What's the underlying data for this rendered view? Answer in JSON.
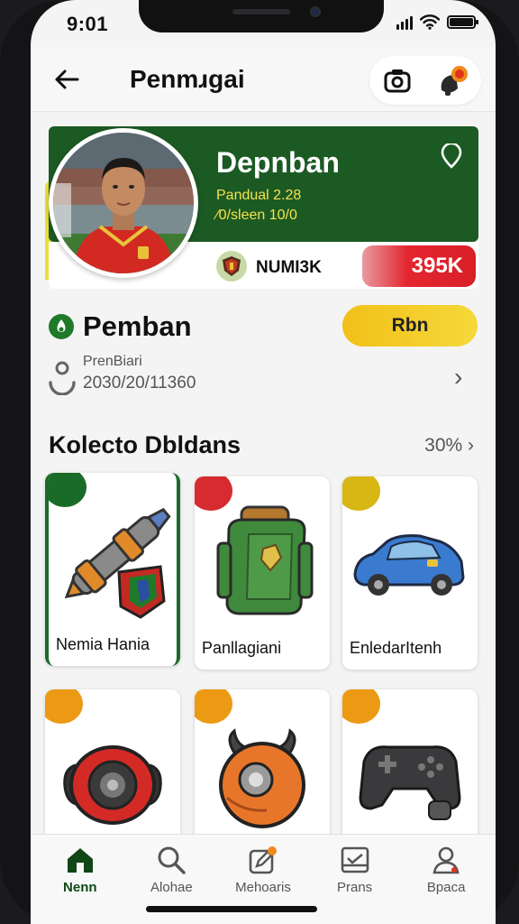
{
  "status_bar": {
    "time": "9:01"
  },
  "header": {
    "title": "Penmɹgai",
    "back_icon": "arrow-left-icon",
    "camera_icon": "camera-icon",
    "profile_icon": "profile-badge-icon"
  },
  "profile_card": {
    "name": "Depnban",
    "line1": "Pandual 2.28",
    "line2": "⁄0/sleen 10/0",
    "club_name": "NUMI3K",
    "value": "395K",
    "colors": {
      "green": "#1c5a24",
      "yellow": "#e8df3c",
      "value_red": "#e4262f"
    }
  },
  "player": {
    "name": "Pemban",
    "button_label": "Rbn",
    "info_label": "PrenBiari",
    "info_value": "2030/20/11360"
  },
  "collection": {
    "title": "Kolecto Dbldans",
    "link": "30%",
    "items": [
      {
        "label": "Nemia Hania",
        "icon": "baton-shield-icon",
        "corner_color": "#1b6b28"
      },
      {
        "label": "Panllagiani",
        "icon": "backpack-icon",
        "corner_color": "#d62b2f"
      },
      {
        "label": "EnledarItenh",
        "icon": "car-icon",
        "corner_color": "#d8b614"
      },
      {
        "label": "",
        "icon": "disc-gadget-icon",
        "corner_color": "#ec9a14"
      },
      {
        "label": "",
        "icon": "orb-gadget-icon",
        "corner_color": "#ec9a14"
      },
      {
        "label": "",
        "icon": "gamepad-icon",
        "corner_color": "#ec9a14"
      }
    ]
  },
  "bottom_nav": {
    "items": [
      {
        "label": "Nenn",
        "icon": "home-icon",
        "active": true
      },
      {
        "label": "Alohae",
        "icon": "search-icon",
        "active": false
      },
      {
        "label": "Mehoaris",
        "icon": "edit-badge-icon",
        "active": false
      },
      {
        "label": "Prans",
        "icon": "inbox-icon",
        "active": false
      },
      {
        "label": "Bpaca",
        "icon": "profile-icon",
        "active": false
      }
    ]
  }
}
